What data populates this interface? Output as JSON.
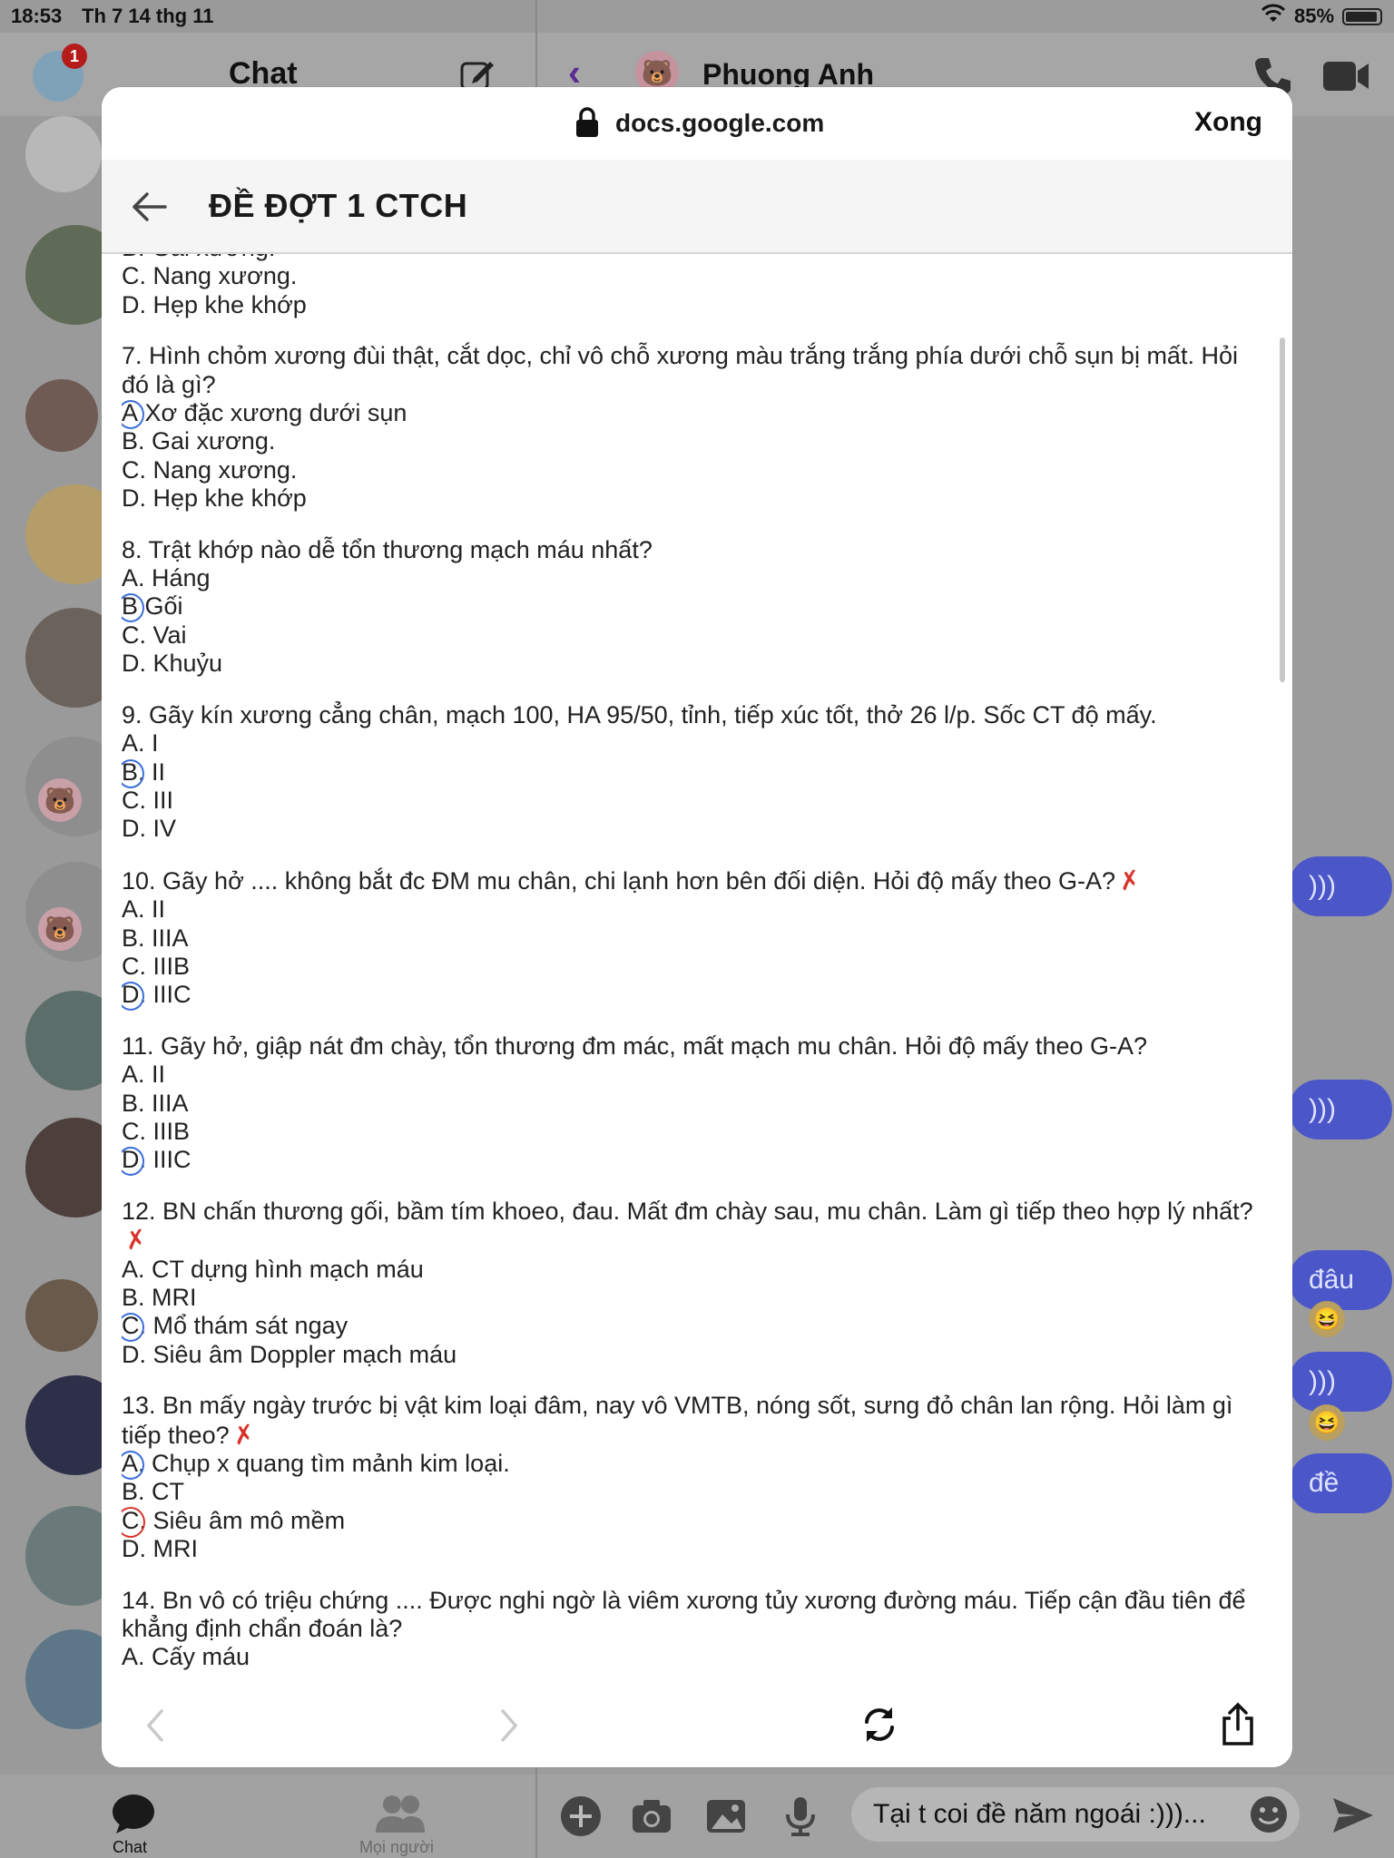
{
  "status_bar": {
    "time": "18:53",
    "date": "Th 7 14 thg 11",
    "battery": "85%"
  },
  "messenger": {
    "title": "Chat",
    "notification_count": "1",
    "peer_name": "Phuong Anh",
    "bubbles": [
      ")))",
      ")))",
      "đâu",
      ")))",
      "đề"
    ],
    "compose_placeholder": "Tại t coi đề năm ngoái :)))...",
    "tabs": [
      {
        "label": "Chat"
      },
      {
        "label": "Mọi người"
      }
    ]
  },
  "browser": {
    "url": "docs.google.com",
    "done_label": "Xong"
  },
  "document": {
    "title": "ĐỀ ĐỢT 1 CTCH",
    "questions": [
      {
        "stem": "",
        "options": [
          "B. Gai xương.",
          "C. Nang xương.",
          "D. Hẹp khe khớp"
        ]
      },
      {
        "stem": "7. Hình chỏm xương đùi thật, cắt dọc, chỉ vô chỗ xương màu trắng trắng phía dưới chỗ sụn bị mất. Hỏi đó là gì?",
        "options": [
          "Xơ đặc xương dưới sụn",
          "B. Gai xương.",
          "C. Nang xương.",
          "D. Hẹp khe khớp"
        ],
        "marked_letter": "A",
        "marked_index": 0
      },
      {
        "stem": "8. Trật khớp nào dễ tổn thương mạch máu nhất?",
        "options": [
          "A. Háng",
          "Gối",
          "C. Vai",
          "D. Khuỷu"
        ],
        "marked_letter": "B",
        "marked_index": 1
      },
      {
        "stem": "9. Gãy kín xương cẳng chân, mạch 100, HA 95/50, tỉnh, tiếp xúc tốt, thở 26 l/p. Sốc CT độ mấy.",
        "options": [
          "A. I",
          ". II",
          "C. III",
          "D. IV"
        ],
        "marked_letter": "B",
        "marked_index": 1
      },
      {
        "stem": "10. Gãy hở .... không bắt đc ĐM mu chân, chi lạnh hơn bên đối diện. Hỏi độ mấy theo G-A?",
        "options": [
          "A. II",
          "B. IIIA",
          "C. IIIB",
          ". IIIC"
        ],
        "marked_letter": "D",
        "marked_index": 3,
        "x_mark": true
      },
      {
        "stem": "11. Gãy hở, giập nát đm chày, tổn thương đm mác, mất mạch mu chân. Hỏi độ mấy theo G-A?",
        "options": [
          "A. II",
          "B. IIIA",
          "C. IIIB",
          ". IIIC"
        ],
        "marked_letter": "D",
        "marked_index": 3
      },
      {
        "stem": "12. BN chấn thương gối, bầm tím khoeo, đau. Mất đm chày sau, mu chân. Làm gì tiếp theo hợp lý nhất?",
        "options": [
          "A. CT dựng hình mạch máu",
          "B. MRI",
          ". Mổ thám sát ngay",
          "D. Siêu âm Doppler mạch máu"
        ],
        "marked_letter": "C",
        "marked_index": 2,
        "x_mark": true
      },
      {
        "stem": "13. Bn mấy ngày trước bị vật kim loại đâm, nay vô VMTB, nóng sốt, sưng đỏ chân lan rộng. Hỏi làm gì tiếp theo?",
        "options": [
          ". Chụp x quang tìm mảnh kim loại.",
          "B. CT",
          ". Siêu âm mô mềm",
          "D. MRI"
        ],
        "marked_letter": "A",
        "marked_index": 0,
        "red_letter": "C",
        "red_index": 2,
        "x_mark": true
      },
      {
        "stem": "14. Bn vô có triệu chứng .... Được nghi ngờ là viêm xương tủy xương đường máu. Tiếp cận đầu tiên để khẳng định chẩn đoán là?",
        "options": [
          "A. Cấy máu"
        ]
      }
    ]
  },
  "colors": {
    "blue_pen": "#3a6fd8",
    "red_pen": "#d9342b",
    "messenger_accent": "#4b57c8"
  }
}
